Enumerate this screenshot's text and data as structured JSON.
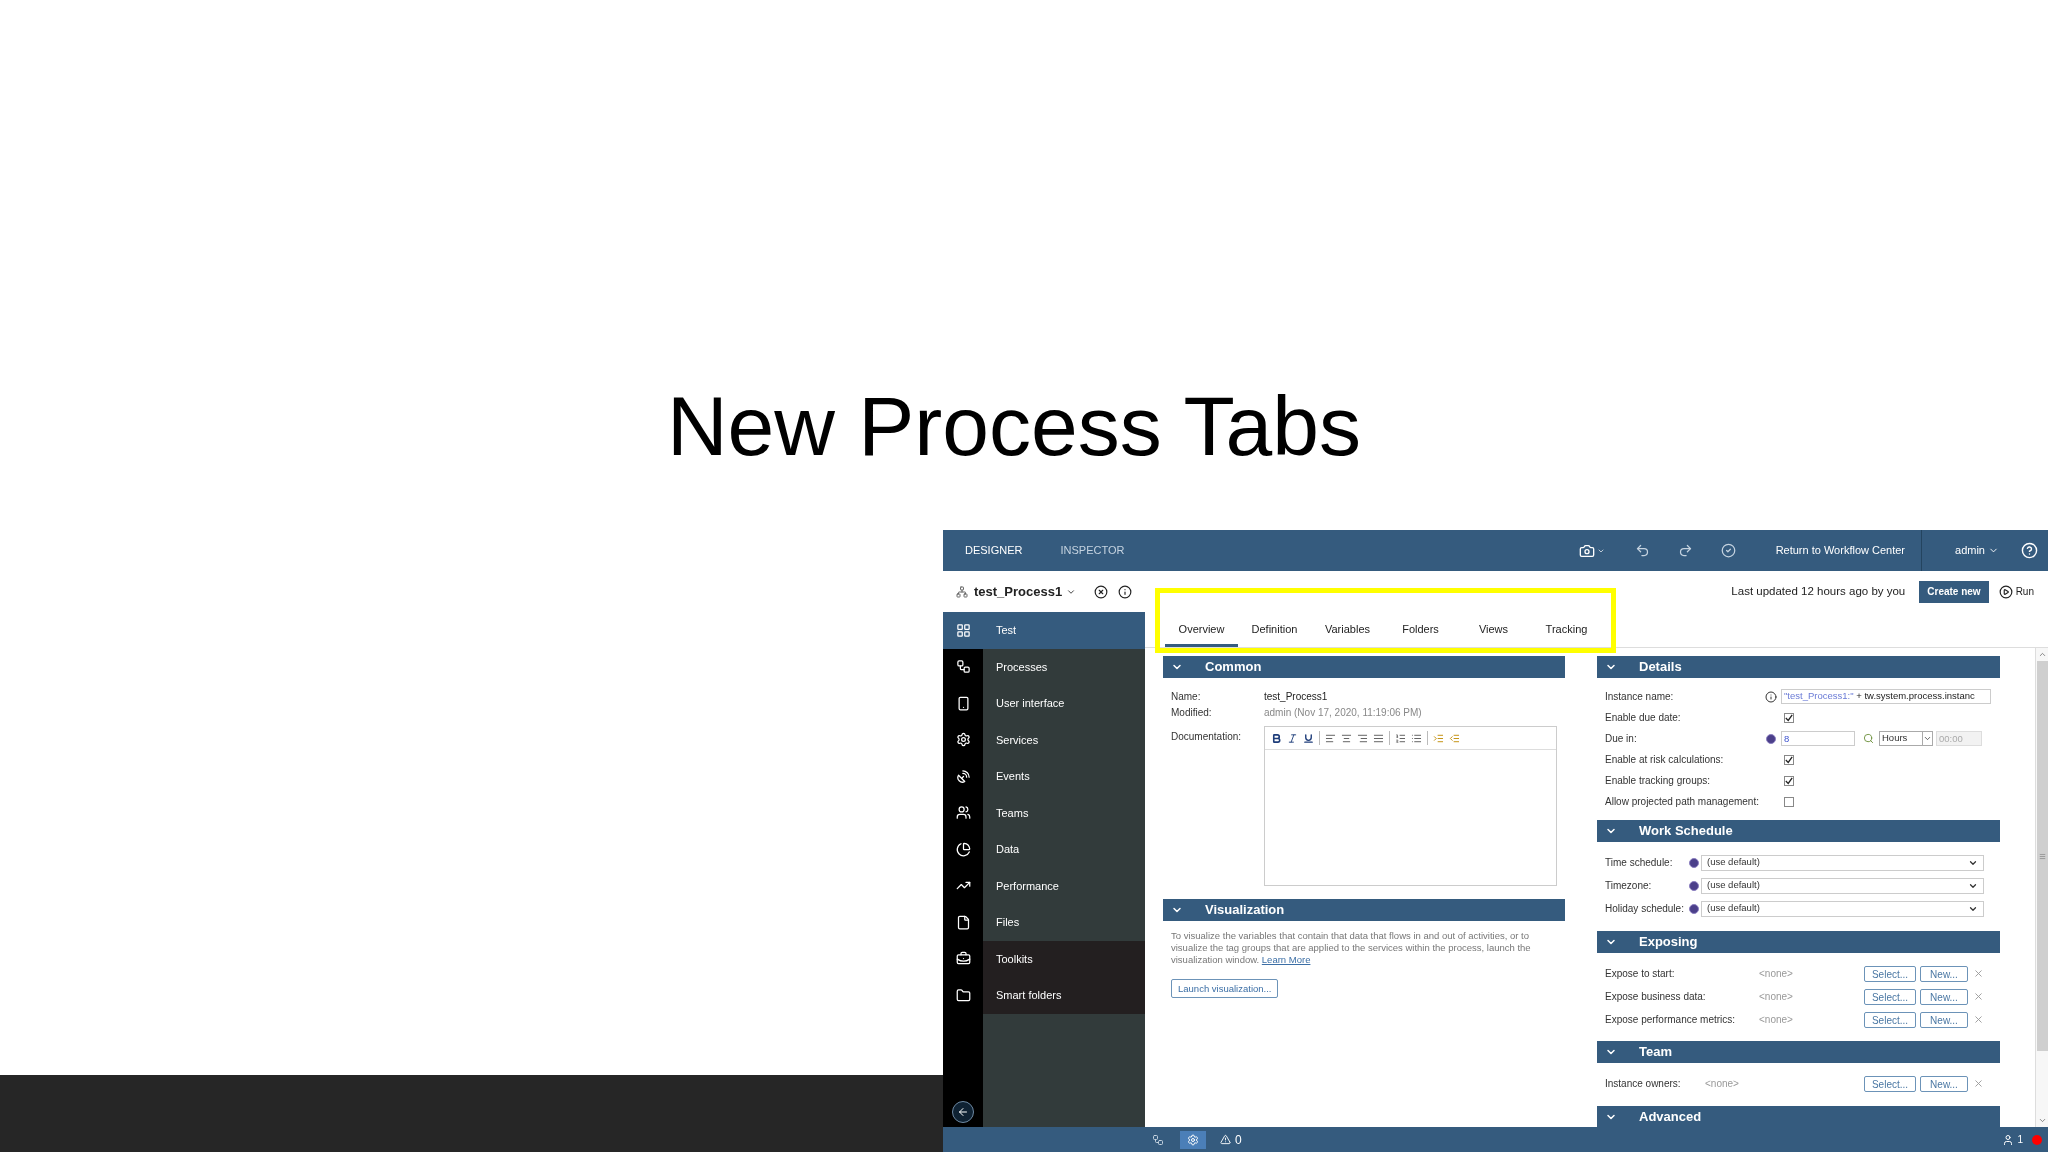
{
  "slide": {
    "title": "New Process Tabs"
  },
  "topbar": {
    "tabs": [
      {
        "label": "DESIGNER",
        "selected": true
      },
      {
        "label": "INSPECTOR",
        "selected": false
      }
    ],
    "return_link": "Return to Workflow Center",
    "user": "admin"
  },
  "header": {
    "process_name": "test_Process1",
    "last_updated": "Last updated 12 hours ago by you",
    "create_button": "Create new",
    "run_button": "Run"
  },
  "sidebar": {
    "items": [
      {
        "label": "Test",
        "selected": true
      },
      {
        "label": "Processes",
        "selected": false,
        "kind": "project"
      },
      {
        "label": "User interface",
        "selected": false,
        "kind": "project"
      },
      {
        "label": "Services",
        "selected": false,
        "kind": "project"
      },
      {
        "label": "Events",
        "selected": false,
        "kind": "project"
      },
      {
        "label": "Teams",
        "selected": false,
        "kind": "project"
      },
      {
        "label": "Data",
        "selected": false,
        "kind": "project"
      },
      {
        "label": "Performance",
        "selected": false,
        "kind": "project"
      },
      {
        "label": "Files",
        "selected": false,
        "kind": "project"
      },
      {
        "label": "Toolkits",
        "selected": false,
        "kind": "library"
      },
      {
        "label": "Smart folders",
        "selected": false,
        "kind": "library"
      }
    ]
  },
  "tabs": [
    {
      "label": "Overview",
      "selected": true
    },
    {
      "label": "Definition",
      "selected": false
    },
    {
      "label": "Variables",
      "selected": false
    },
    {
      "label": "Folders",
      "selected": false
    },
    {
      "label": "Views",
      "selected": false
    },
    {
      "label": "Tracking",
      "selected": false
    }
  ],
  "common": {
    "title": "Common",
    "fields": [
      {
        "label": "Name:",
        "value": "test_Process1"
      },
      {
        "label": "Modified:",
        "value": "admin (Nov 17, 2020, 11:19:06 PM)"
      }
    ],
    "documentation_label": "Documentation:"
  },
  "visualization": {
    "title": "Visualization",
    "text": "To visualize the variables that contain that data that flows in and out of activities, or to visualize the tag groups that are applied to the services within the process, launch the visualization window.",
    "link": "Learn More",
    "button": "Launch visualization..."
  },
  "details": {
    "title": "Details",
    "rows": [
      {
        "kind": "text",
        "label": "Instance name:",
        "literal": "\"test_Process1:\"",
        "expression": " + tw.system.process.instanc"
      },
      {
        "kind": "checkbox",
        "label": "Enable due date:",
        "checked": true
      },
      {
        "kind": "duration",
        "label": "Due in:",
        "value": "8",
        "unit": "Hours",
        "time": "00:00"
      },
      {
        "kind": "checkbox",
        "label": "Enable at risk calculations:",
        "checked": true
      },
      {
        "kind": "checkbox",
        "label": "Enable tracking groups:",
        "checked": true
      },
      {
        "kind": "checkbox",
        "label": "Allow projected path management:",
        "checked": false
      }
    ]
  },
  "work_schedule": {
    "title": "Work Schedule",
    "rows": [
      {
        "label": "Time schedule:",
        "value": "(use default)"
      },
      {
        "label": "Timezone:",
        "value": "(use default)"
      },
      {
        "label": "Holiday schedule:",
        "value": "(use default)"
      }
    ]
  },
  "exposing": {
    "title": "Exposing",
    "rows": [
      {
        "label": "Expose to start:",
        "value": "<none>",
        "select": "Select...",
        "new": "New..."
      },
      {
        "label": "Expose business data:",
        "value": "<none>",
        "select": "Select...",
        "new": "New..."
      },
      {
        "label": "Expose performance metrics:",
        "value": "<none>",
        "select": "Select...",
        "new": "New..."
      }
    ]
  },
  "team": {
    "title": "Team",
    "rows": [
      {
        "label": "Instance owners:",
        "value": "<none>",
        "select": "Select...",
        "new": "New..."
      }
    ]
  },
  "advanced": {
    "title": "Advanced"
  },
  "status_bar": {
    "warnings": "0",
    "users": "1"
  }
}
